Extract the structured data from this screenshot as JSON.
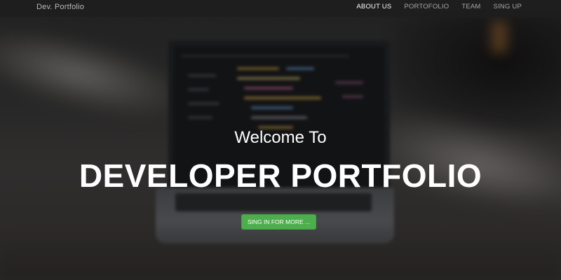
{
  "navbar": {
    "brand": "Dev. Portfolio",
    "links": [
      {
        "label": "ABOUT US",
        "active": true
      },
      {
        "label": "PORTOFOLIO",
        "active": false
      },
      {
        "label": "TEAM",
        "active": false
      },
      {
        "label": "SING UP",
        "active": false
      }
    ]
  },
  "hero": {
    "subtitle": "Welcome To",
    "title": "DEVELOPER PORTFOLIO",
    "cta_label": "SING IN FOR MORE ..."
  },
  "colors": {
    "cta": "#4cae4c",
    "navbar": "#1e1e1e",
    "text": "#ffffff"
  }
}
